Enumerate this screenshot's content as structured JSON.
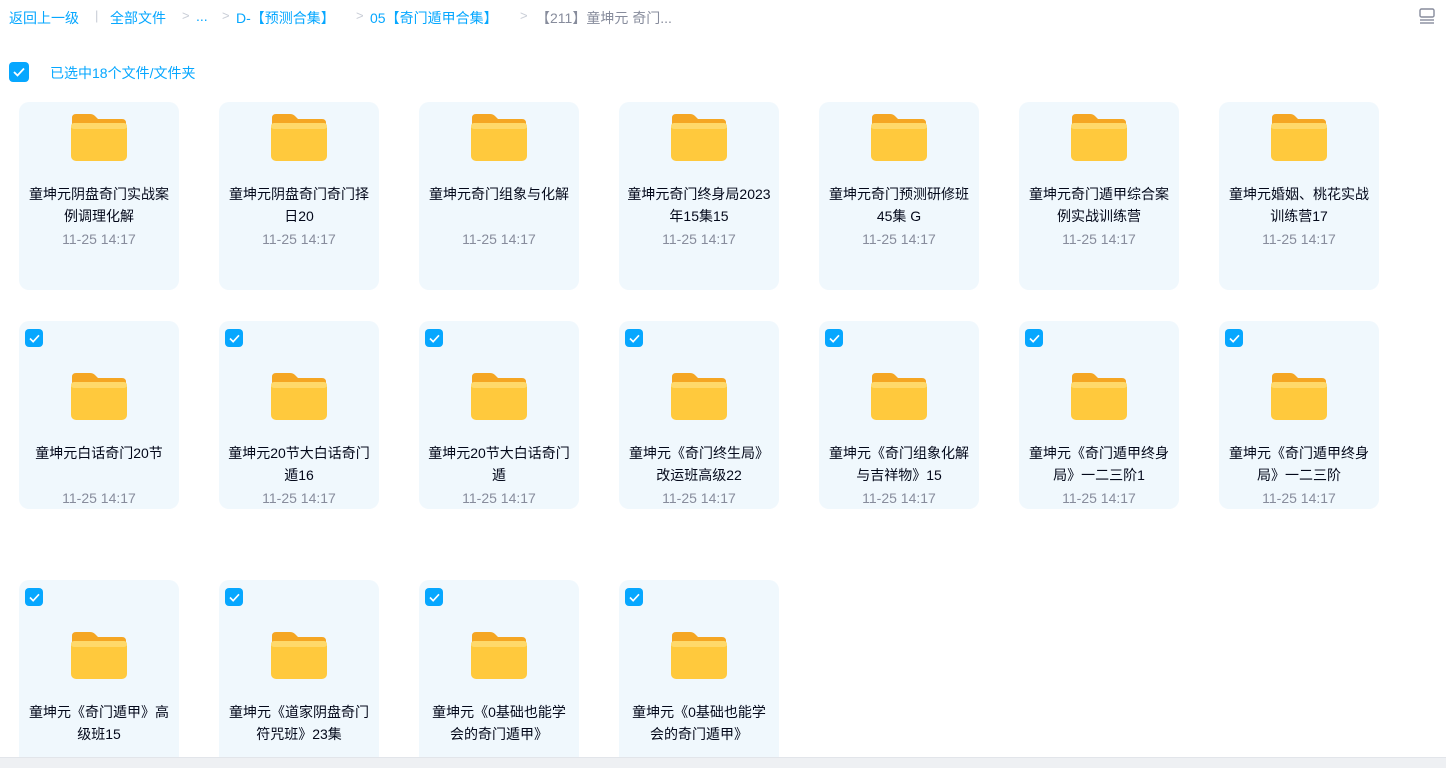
{
  "breadcrumb": {
    "back": "返回上一级",
    "sep": "|",
    "all_files": "全部文件",
    "ellipsis": "...",
    "level1": "D-【预测合集】",
    "level2": "05【奇门遁甲合集】",
    "current": "【211】童坤元 奇门...",
    "chevron": ">"
  },
  "selection": {
    "label": "已选中18个文件/文件夹",
    "icon": "checkbox-checked-icon"
  },
  "icons": {
    "folder": "folder-icon",
    "view_toggle": "list-view-icon",
    "accent": "#06a7ff",
    "folder_color": "#ffc23d"
  },
  "files": [
    {
      "name": "童坤元阴盘奇门实战案例调理化解",
      "time": "11-25 14:17",
      "checked": false
    },
    {
      "name": "童坤元阴盘奇门奇门择日20",
      "time": "11-25 14:17",
      "checked": false
    },
    {
      "name": "童坤元奇门组象与化解",
      "time": "11-25 14:17",
      "checked": false
    },
    {
      "name": "童坤元奇门终身局2023年15集15",
      "time": "11-25 14:17",
      "checked": false
    },
    {
      "name": "童坤元奇门预测研修班45集 G",
      "time": "11-25 14:17",
      "checked": false
    },
    {
      "name": "童坤元奇门遁甲综合案例实战训练营",
      "time": "11-25 14:17",
      "checked": false
    },
    {
      "name": "童坤元婚姻、桃花实战训练营17",
      "time": "11-25 14:17",
      "checked": false
    },
    {
      "name": "童坤元白话奇门20节",
      "time": "11-25 14:17",
      "checked": true
    },
    {
      "name": "童坤元20节大白话奇门遁16",
      "time": "11-25 14:17",
      "checked": true
    },
    {
      "name": "童坤元20节大白话奇门遁",
      "time": "11-25 14:17",
      "checked": true
    },
    {
      "name": "童坤元《奇门终生局》改运班高级22",
      "time": "11-25 14:17",
      "checked": true
    },
    {
      "name": "童坤元《奇门组象化解与吉祥物》15",
      "time": "11-25 14:17",
      "checked": true
    },
    {
      "name": "童坤元《奇门遁甲终身局》一二三阶1",
      "time": "11-25 14:17",
      "checked": true
    },
    {
      "name": "童坤元《奇门遁甲终身局》一二三阶",
      "time": "11-25 14:17",
      "checked": true
    },
    {
      "name": "童坤元《奇门遁甲》高级班15",
      "time": "",
      "checked": true
    },
    {
      "name": "童坤元《道家阴盘奇门符咒班》23集",
      "time": "",
      "checked": true
    },
    {
      "name": "童坤元《0基础也能学会的奇门遁甲》",
      "time": "",
      "checked": true
    },
    {
      "name": "童坤元《0基础也能学会的奇门遁甲》",
      "time": "",
      "checked": true
    }
  ]
}
